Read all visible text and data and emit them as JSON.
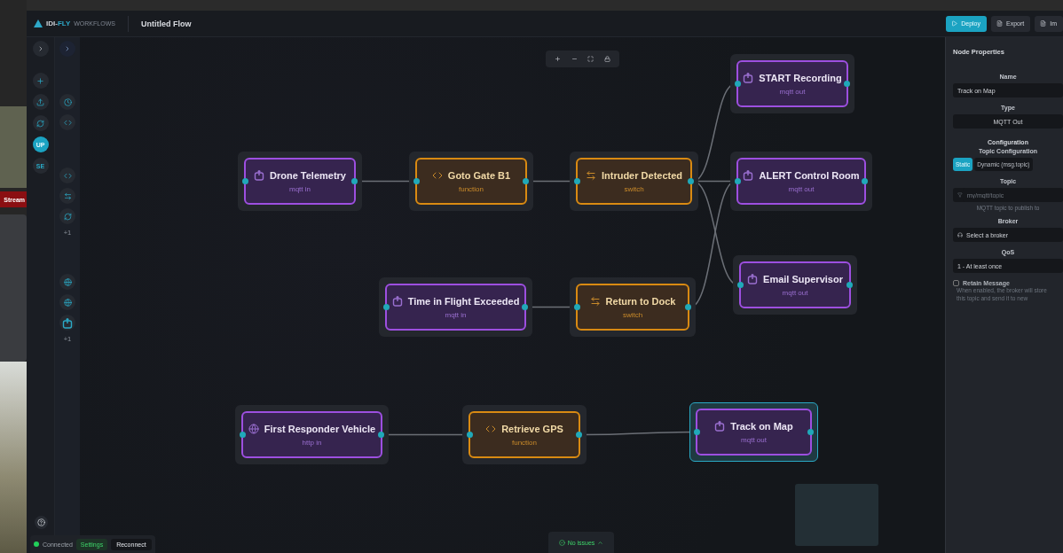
{
  "background_window": {
    "stream_button": "Stream"
  },
  "header": {
    "logo_primary": "IDI-",
    "logo_accent": "FLY",
    "logo_suffix": "WORKFLOWS",
    "flow_title": "Untitled Flow",
    "buttons": [
      {
        "label": "Deploy",
        "kind": "primary"
      },
      {
        "label": "Export",
        "kind": "file"
      },
      {
        "label": "Im",
        "kind": "file"
      }
    ]
  },
  "rail": {
    "items": [
      {
        "kind": "plus"
      },
      {
        "kind": "upload"
      },
      {
        "kind": "sync"
      },
      {
        "kind": "text",
        "label": "UP",
        "selected": true
      },
      {
        "kind": "text",
        "label": "SE",
        "selected": false
      }
    ]
  },
  "palette": {
    "groups": [
      {
        "icons": [
          {
            "kind": "clock"
          },
          {
            "kind": "code"
          }
        ]
      },
      {
        "icons": [
          {
            "kind": "code"
          },
          {
            "kind": "switch"
          },
          {
            "kind": "sync"
          }
        ],
        "more": "+1"
      },
      {
        "icons": [
          {
            "kind": "globe"
          },
          {
            "kind": "globe"
          },
          {
            "kind": "mqtt"
          }
        ],
        "more": "+1"
      }
    ]
  },
  "nodes": [
    {
      "title": "Drone Telemetry",
      "type": "mqtt in",
      "kind": "mqtt",
      "selected": false
    },
    {
      "title": "Goto Gate B1",
      "type": "function",
      "kind": "function",
      "selected": false
    },
    {
      "title": "Intruder Detected",
      "type": "switch",
      "kind": "switch",
      "selected": false
    },
    {
      "title": "START Recording",
      "type": "mqtt out",
      "kind": "mqtt",
      "selected": false
    },
    {
      "title": "ALERT Control Room",
      "type": "mqtt out",
      "kind": "mqtt",
      "selected": false
    },
    {
      "title": "Email Supervisor",
      "type": "mqtt out",
      "kind": "mqtt",
      "selected": false
    },
    {
      "title": "Time in Flight Exceeded",
      "type": "mqtt in",
      "kind": "mqtt",
      "selected": false
    },
    {
      "title": "Return to Dock",
      "type": "switch",
      "kind": "switch",
      "selected": false
    },
    {
      "title": "First Responder Vehicle",
      "type": "http in",
      "kind": "http",
      "selected": false
    },
    {
      "title": "Retrieve GPS",
      "type": "function",
      "kind": "function",
      "selected": false
    },
    {
      "title": "Track on Map",
      "type": "mqtt out",
      "kind": "mqtt",
      "selected": true
    }
  ],
  "status": {
    "connection": "Connected",
    "connected": true,
    "settings": "Settings",
    "reconnect": "Reconnect",
    "issues": "No issues"
  },
  "properties": {
    "title": "Node Properties",
    "name_label": "Name",
    "name_value": "Track on Map",
    "type_label": "Type",
    "type_value": "MQTT Out",
    "section": "Configuration",
    "topic_config_label": "Topic Configuration",
    "topic_modes": [
      {
        "label": "Static",
        "selected": true
      },
      {
        "label": "Dynamic (msg.topic)",
        "selected": false
      }
    ],
    "topic_label": "Topic",
    "topic_placeholder": "my/mqtt/topic",
    "topic_hint": "MQTT topic to publish to",
    "broker_label": "Broker",
    "broker_value": "Select a broker",
    "qos_label": "QoS",
    "qos_value": "1 - At least once",
    "retain": {
      "label": "Retain Message",
      "checked": false
    },
    "retain_help": [
      "When enabled, the broker will store",
      "this topic and send it to new"
    ]
  }
}
